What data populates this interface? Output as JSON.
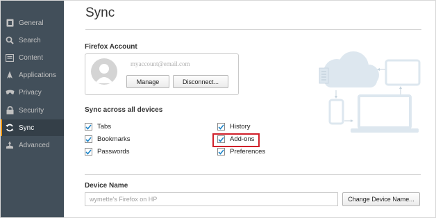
{
  "sidebar": {
    "items": [
      {
        "label": "General",
        "icon": "general-icon",
        "active": false
      },
      {
        "label": "Search",
        "icon": "search-icon",
        "active": false
      },
      {
        "label": "Content",
        "icon": "content-icon",
        "active": false
      },
      {
        "label": "Applications",
        "icon": "applications-icon",
        "active": false
      },
      {
        "label": "Privacy",
        "icon": "privacy-icon",
        "active": false
      },
      {
        "label": "Security",
        "icon": "security-icon",
        "active": false
      },
      {
        "label": "Sync",
        "icon": "sync-icon",
        "active": true
      },
      {
        "label": "Advanced",
        "icon": "advanced-icon",
        "active": false
      }
    ]
  },
  "page": {
    "title": "Sync"
  },
  "account": {
    "heading": "Firefox Account",
    "email": "myaccount@email.com",
    "manage_label": "Manage",
    "disconnect_label": "Disconnect..."
  },
  "sync": {
    "heading": "Sync across all devices",
    "options": [
      {
        "label": "Tabs",
        "checked": true
      },
      {
        "label": "Bookmarks",
        "checked": true
      },
      {
        "label": "Passwords",
        "checked": true
      },
      {
        "label": "History",
        "checked": true
      },
      {
        "label": "Add-ons",
        "checked": true,
        "highlighted": true
      },
      {
        "label": "Preferences",
        "checked": true
      }
    ]
  },
  "device": {
    "heading": "Device Name",
    "name_value": "wymette's Firefox on HP",
    "change_label": "Change Device Name..."
  },
  "colors": {
    "sidebar_bg": "#424f5a",
    "sidebar_active_bg": "#343f48",
    "active_accent": "#ff9500",
    "highlight_border": "#d0202a",
    "check_color": "#1f86c9"
  }
}
